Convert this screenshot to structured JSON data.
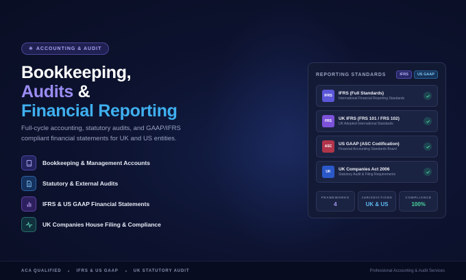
{
  "badge": {
    "icon": "sparkle-icon",
    "label": "ACCOUNTING & AUDIT"
  },
  "headline": {
    "line1": "Bookkeeping,",
    "line2": "Audits",
    "amp": " &",
    "line3": "Financial Reporting"
  },
  "subtitle": "Full-cycle accounting, statutory audits, and GAAP/IFRS compliant financial statements for UK and US entities.",
  "features": [
    {
      "icon": "book-icon",
      "label": "Bookkeeping & Management Accounts"
    },
    {
      "icon": "document-icon",
      "label": "Statutory & External Audits"
    },
    {
      "icon": "bar-chart-icon",
      "label": "IFRS & US GAAP Financial Statements"
    },
    {
      "icon": "activity-icon",
      "label": "UK Companies House Filing & Compliance"
    }
  ],
  "panel": {
    "title": "REPORTING STANDARDS",
    "tags": [
      "IFRS",
      "US GAAP"
    ],
    "standards": [
      {
        "abbr": "IFRS",
        "name": "IFRS (Full Standards)",
        "desc": "International Financial Reporting Standards"
      },
      {
        "abbr": "FRS",
        "name": "UK IFRS (FRS 101 / FRS 102)",
        "desc": "UK Adopted International Standards"
      },
      {
        "abbr": "ASC",
        "name": "US GAAP (ASC Codification)",
        "desc": "Financial Accounting Standards Board"
      },
      {
        "abbr": "UK",
        "name": "UK Companies Act 2006",
        "desc": "Statutory Audit & Filing Requirements"
      }
    ],
    "stats": [
      {
        "label": "FRAMEWORKS",
        "value": "4"
      },
      {
        "label": "JURISDICTIONS",
        "value": "UK & US"
      },
      {
        "label": "COMPLIANCE",
        "value": "100%"
      }
    ]
  },
  "footer": {
    "items": [
      "ACA QUALIFIED",
      "IFRS & US GAAP",
      "UK STATUTORY AUDIT"
    ],
    "right": "Professional Accounting & Audit Services"
  },
  "colors": {
    "accent_purple": "#9b8cf3",
    "accent_blue": "#3fb0f0",
    "accent_green": "#49d49c",
    "background": "#0d1330"
  }
}
